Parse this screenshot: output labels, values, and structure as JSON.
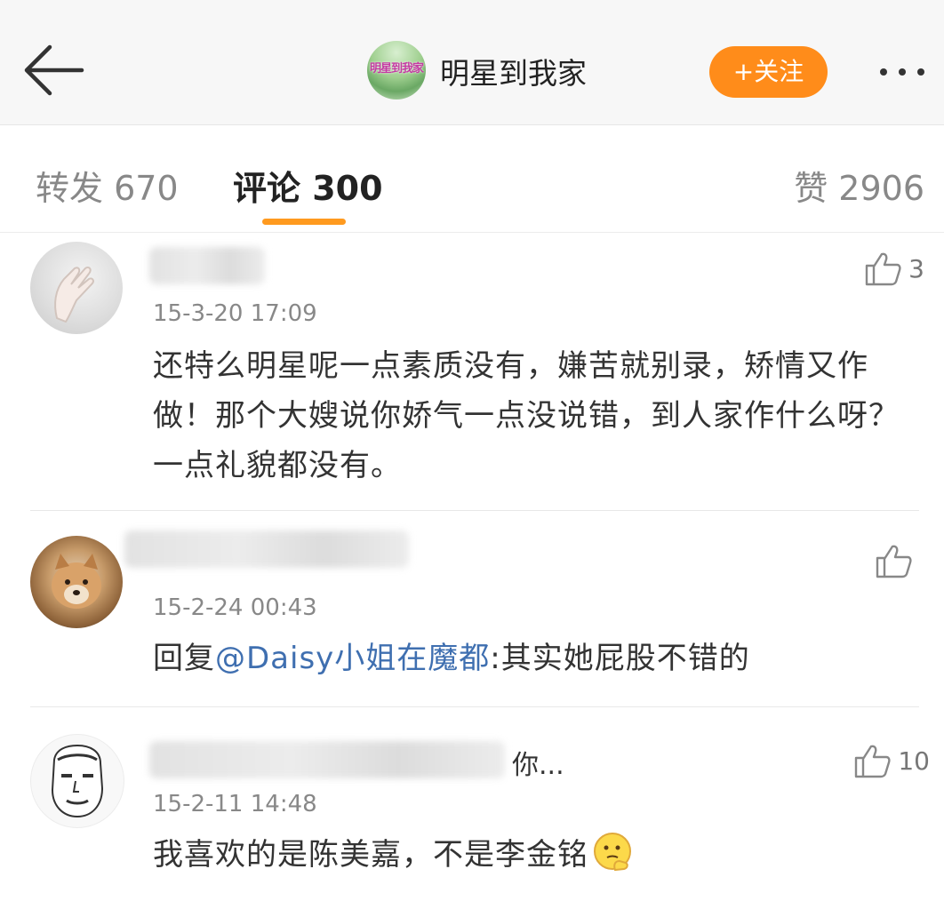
{
  "header": {
    "account_name": "明星到我家",
    "follow_label": "+关注",
    "icons": {
      "back": "arrow-left-icon",
      "more": "more-dots-icon"
    },
    "accent_color": "#ff8c1a"
  },
  "tabs": [
    {
      "label": "转发 670",
      "active": false
    },
    {
      "label": "评论 300",
      "active": true
    },
    {
      "label": "赞 2906",
      "active": false
    }
  ],
  "comments": [
    {
      "name_suffix": "",
      "time": "15-3-20 17:09",
      "likes": "3",
      "text": "还特么明星呢一点素质没有，嫌苦就别录，矫情又作做！那个大嫂说你娇气一点没说错，到人家作什么呀？一点礼貌都没有。"
    },
    {
      "name_suffix": "",
      "time": "15-2-24 00:43",
      "likes": "",
      "text_prefix": "回复",
      "mention": "@Daisy小姐在魔都",
      "text_suffix": ":其实她屁股不错的"
    },
    {
      "name_suffix": "你...",
      "time": "15-2-11 14:48",
      "likes": "10",
      "text": "我喜欢的是陈美嘉，不是李金铭",
      "emoji": "thinking-face-icon"
    }
  ]
}
